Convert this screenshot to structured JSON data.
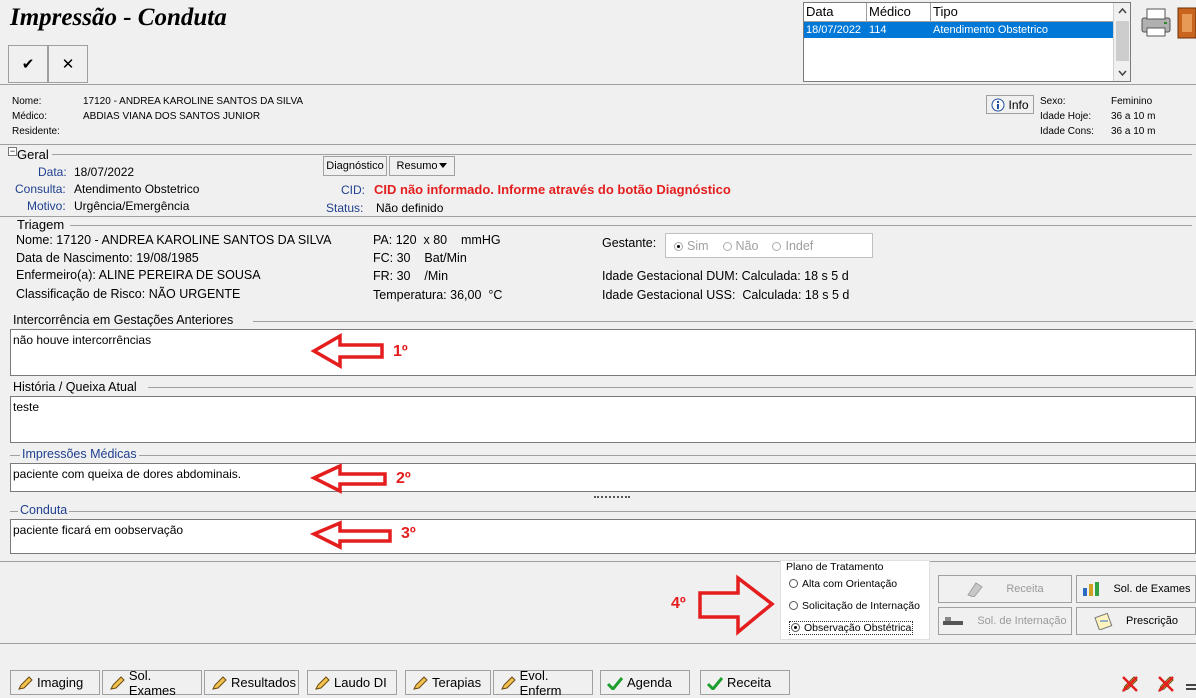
{
  "window": {
    "title": "Impressão - Conduta"
  },
  "toolbar": {
    "confirm": "✔",
    "cancel": "✕"
  },
  "list": {
    "headers": [
      "Data",
      "Médico",
      "Tipo"
    ],
    "row": [
      "18/07/2022",
      "114",
      "Atendimento Obstetrico"
    ]
  },
  "patient": {
    "nome_label": "Nome:",
    "nome": "17120 - ANDREA  KAROLINE SANTOS DA SILVA",
    "medico_label": "Médico:",
    "medico": "ABDIAS VIANA DOS SANTOS JUNIOR",
    "residente_label": "Residente:",
    "info_button": "Info",
    "sexo_label": "Sexo:",
    "sexo": "Feminino",
    "idade_hoje_label": "Idade Hoje:",
    "idade_hoje": "36 a 10 m",
    "idade_cons_label": "Idade Cons:",
    "idade_cons": "36 a 10 m"
  },
  "geral": {
    "legend": "Geral",
    "data_label": "Data:",
    "data": "18/07/2022",
    "consulta_label": "Consulta:",
    "consulta": "Atendimento Obstetrico",
    "motivo_label": "Motivo:",
    "motivo": "Urgência/Emergência",
    "diagnostico_button": "Diagnóstico",
    "resumo_button": "Resumo",
    "cid_label": "CID:",
    "cid": "CID não informado. Informe através do botão Diagnóstico",
    "status_label": "Status:",
    "status": "Não definido"
  },
  "triagem": {
    "legend": "Triagem",
    "nome": "Nome: 17120 - ANDREA  KAROLINE SANTOS DA SILVA",
    "nascimento": "Data de Nascimento: 19/08/1985",
    "enfermeiro": "Enfermeiro(a): ALINE PEREIRA DE SOUSA",
    "risco": "Classificação de Risco: NÃO URGENTE",
    "pa": "PA: 120  x 80    mmHG",
    "fc": "FC: 30    Bat/Min",
    "fr": "FR: 30    /Min",
    "temperatura": "Temperatura: 36,00  °C",
    "gestante_label": "Gestante:",
    "gestante_options": [
      "Sim",
      "Não",
      "Indef"
    ],
    "ig_dum": "Idade Gestacional DUM: Calculada: 18 s 5 d",
    "ig_uss": "Idade Gestacional USS:  Calculada: 18 s 5 d"
  },
  "intercorrencia": {
    "legend": "Intercorrência em Gestações Anteriores",
    "value": "não houve intercorrências",
    "annotation": "1º"
  },
  "historia": {
    "legend": "História / Queixa Atual",
    "value": "teste"
  },
  "impressoes": {
    "legend": "Impressões Médicas",
    "value": "paciente com queixa de dores abdominais.",
    "annotation": "2º"
  },
  "conduta": {
    "legend": "Conduta",
    "value": "paciente ficará em oobservação",
    "annotation": "3º"
  },
  "plano": {
    "legend": "Plano de Tratamento",
    "options": [
      "Alta com Orientação",
      "Solicitação de Internação",
      "Observação Obstétrica"
    ],
    "annotation": "4º"
  },
  "actions": {
    "receita": "Receita",
    "sol_exames": "Sol. de Exames",
    "sol_internacao": "Sol. de Internação",
    "prescricao": "Prescrição"
  },
  "bottom_tabs": [
    "Imaging",
    "Sol. Exames",
    "Resultados",
    "Laudo DI",
    "Terapias",
    "Evol. Enferm",
    "Agenda",
    "Receita"
  ]
}
